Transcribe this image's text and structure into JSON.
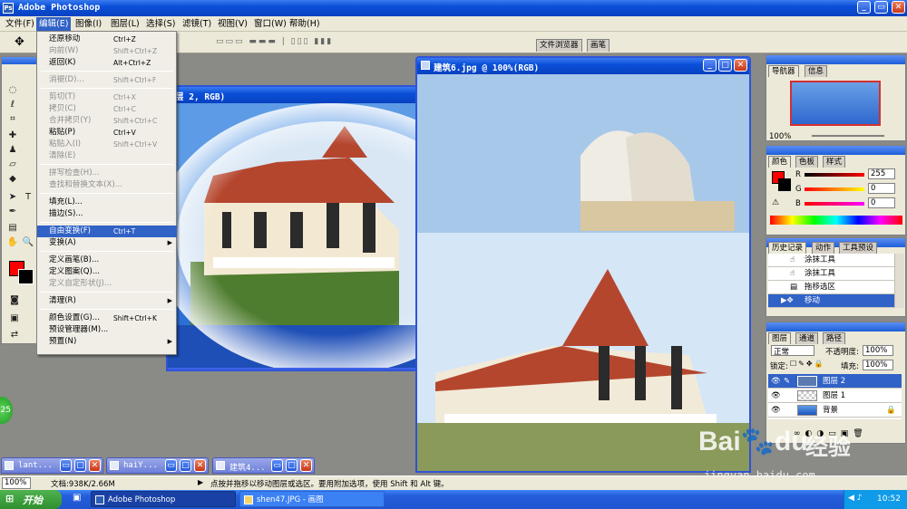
{
  "app": {
    "title": "Adobe Photoshop"
  },
  "menubar": [
    "文件(F)",
    "编辑(E)",
    "图像(I)",
    "图层(L)",
    "选择(S)",
    "滤镜(T)",
    "视图(V)",
    "窗口(W)",
    "帮助(H)"
  ],
  "options": {
    "move_label": "中",
    "browser_tab": "文件浏览器",
    "brush_tab": "画笔"
  },
  "edit_menu": {
    "items": [
      {
        "label": "还原移动",
        "shortcut": "Ctrl+Z",
        "state": "enabled"
      },
      {
        "label": "向前(W)",
        "shortcut": "Shift+Ctrl+Z",
        "state": "disabled"
      },
      {
        "label": "返回(K)",
        "shortcut": "Alt+Ctrl+Z",
        "state": "enabled"
      },
      {
        "sep": true
      },
      {
        "label": "消褪(D)...",
        "shortcut": "Shift+Ctrl+F",
        "state": "disabled"
      },
      {
        "sep": true
      },
      {
        "label": "剪切(T)",
        "shortcut": "Ctrl+X",
        "state": "disabled"
      },
      {
        "label": "拷贝(C)",
        "shortcut": "Ctrl+C",
        "state": "disabled"
      },
      {
        "label": "合并拷贝(Y)",
        "shortcut": "Shift+Ctrl+C",
        "state": "disabled"
      },
      {
        "label": "粘贴(P)",
        "shortcut": "Ctrl+V",
        "state": "enabled"
      },
      {
        "label": "粘贴入(I)",
        "shortcut": "Shift+Ctrl+V",
        "state": "disabled"
      },
      {
        "label": "清除(E)",
        "shortcut": "",
        "state": "disabled"
      },
      {
        "sep": true
      },
      {
        "label": "拼写检查(H)...",
        "shortcut": "",
        "state": "disabled"
      },
      {
        "label": "查找和替换文本(X)...",
        "shortcut": "",
        "state": "disabled"
      },
      {
        "sep": true
      },
      {
        "label": "填充(L)...",
        "shortcut": "",
        "state": "enabled"
      },
      {
        "label": "描边(S)...",
        "shortcut": "",
        "state": "enabled"
      },
      {
        "sep": true
      },
      {
        "label": "自由变换(F)",
        "shortcut": "Ctrl+T",
        "state": "selected"
      },
      {
        "label": "变换(A)",
        "shortcut": "",
        "state": "enabled",
        "submenu": true
      },
      {
        "sep": true
      },
      {
        "label": "定义画笔(B)...",
        "shortcut": "",
        "state": "enabled"
      },
      {
        "label": "定义图案(Q)...",
        "shortcut": "",
        "state": "enabled"
      },
      {
        "label": "定义自定形状(J)...",
        "shortcut": "",
        "state": "disabled"
      },
      {
        "sep": true
      },
      {
        "label": "清理(R)",
        "shortcut": "",
        "state": "enabled",
        "submenu": true
      },
      {
        "sep": true
      },
      {
        "label": "颜色设置(G)...",
        "shortcut": "Shift+Ctrl+K",
        "state": "enabled"
      },
      {
        "label": "预设管理器(M)...",
        "shortcut": "",
        "state": "enabled"
      },
      {
        "label": "预置(N)",
        "shortcut": "",
        "state": "enabled",
        "submenu": true
      }
    ]
  },
  "doc_main": {
    "title": "层 2, RGB)"
  },
  "doc_right": {
    "title": "建筑6.jpg @ 100%(RGB)"
  },
  "navigator": {
    "tabs": [
      "导航器",
      "信息"
    ],
    "zoom": "100%"
  },
  "color": {
    "tabs": [
      "颜色",
      "色板",
      "样式"
    ],
    "r": "255",
    "g": "0",
    "b": "0",
    "r_label": "R",
    "g_label": "G",
    "b_label": "B"
  },
  "history": {
    "tabs": [
      "历史记录",
      "动作",
      "工具预设"
    ],
    "items": [
      "涂抹工具",
      "涂抹工具",
      "拖移选区",
      "移动"
    ]
  },
  "layers": {
    "tabs": [
      "图层",
      "通道",
      "路径"
    ],
    "blend": "正常",
    "opacity_label": "不透明度:",
    "opacity": "100%",
    "lock_label": "锁定:",
    "fill_label": "填充:",
    "fill": "100%",
    "items": [
      "图层 2",
      "图层 1",
      "背景"
    ]
  },
  "minimized": [
    "lant...",
    "haiY...",
    "建筑4..."
  ],
  "status": {
    "zoom": "100%",
    "doc": "文档:938K/2.66M",
    "hint": "点按并拖移以移动图层或选区。要用附加选项，使用 Shift 和 Alt 键。"
  },
  "taskbar": {
    "start": "开始",
    "items": [
      "Adobe Photoshop",
      "shen47.JPG - 画图"
    ],
    "clock": "10:52"
  },
  "badge": "25",
  "watermark": {
    "brand": "Bai",
    "brand2": "du",
    "cn": "经验",
    "url": "jingyan.baidu.com"
  }
}
